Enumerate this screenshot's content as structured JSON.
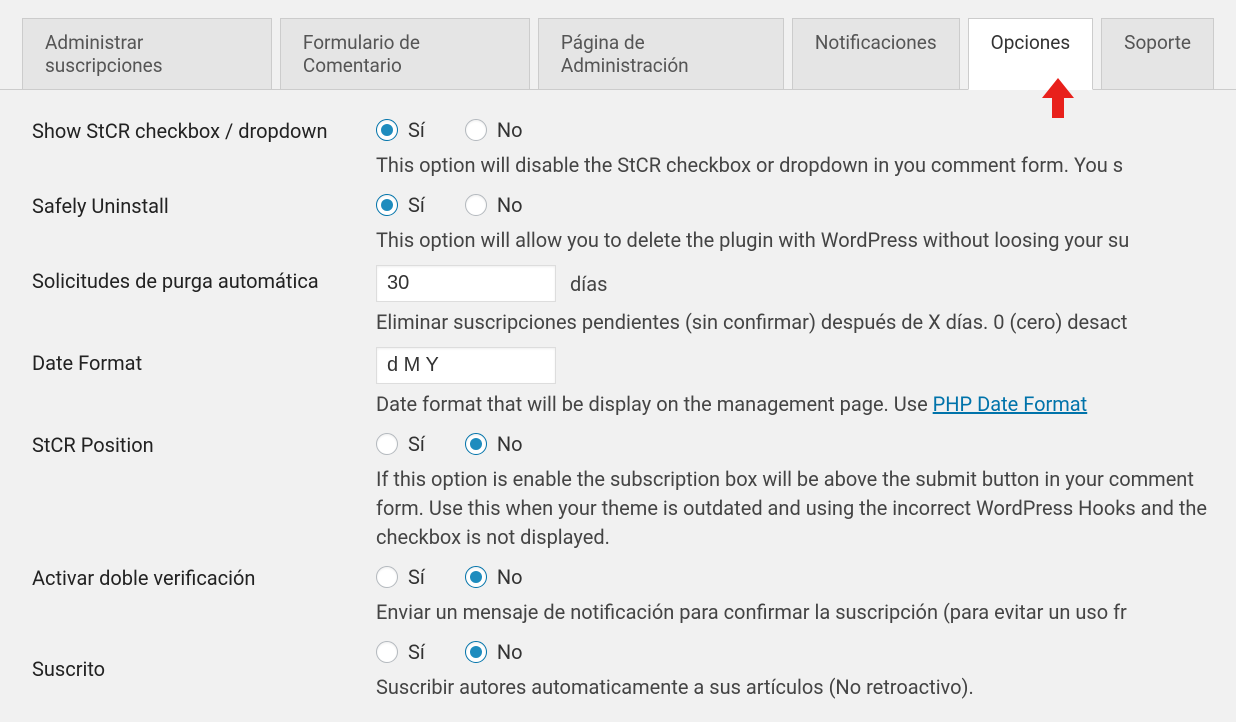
{
  "tabs": [
    {
      "label": "Administrar suscripciones",
      "active": false
    },
    {
      "label": "Formulario de Comentario",
      "active": false
    },
    {
      "label": "Página de Administración",
      "active": false
    },
    {
      "label": "Notificaciones",
      "active": false
    },
    {
      "label": "Opciones",
      "active": true
    },
    {
      "label": "Soporte",
      "active": false
    }
  ],
  "yes": "Sí",
  "no": "No",
  "rows": {
    "show_checkbox": {
      "label": "Show StCR checkbox / dropdown",
      "selected": "yes",
      "description": "This option will disable the StCR checkbox or dropdown in you comment form. You s"
    },
    "safely_uninstall": {
      "label": "Safely Uninstall",
      "selected": "yes",
      "description": "This option will allow you to delete the plugin with WordPress without loosing your su"
    },
    "purge": {
      "label": "Solicitudes de purga automática",
      "value": "30",
      "unit": "días",
      "description": "Eliminar suscripciones pendientes (sin confirmar) después de X días. 0 (cero) desact"
    },
    "date_format": {
      "label": "Date Format",
      "value": "d M Y",
      "description_pre": "Date format that will be display on the management page. Use ",
      "link": "PHP Date Format"
    },
    "stcr_position": {
      "label": "StCR Position",
      "selected": "no",
      "description": "If this option is enable the subscription box will be above the submit button in your comment form. Use this when your theme is outdated and using the incorrect WordPress Hooks and the checkbox is not displayed."
    },
    "double_check": {
      "label": "Activar doble verificación",
      "selected": "no",
      "description": "Enviar un mensaje de notificación para confirmar la suscripción (para evitar un uso fr"
    },
    "subscribed": {
      "label": "Suscrito",
      "selected": "no",
      "description": "Suscribir autores automaticamente a sus artículos (No retroactivo)."
    }
  }
}
